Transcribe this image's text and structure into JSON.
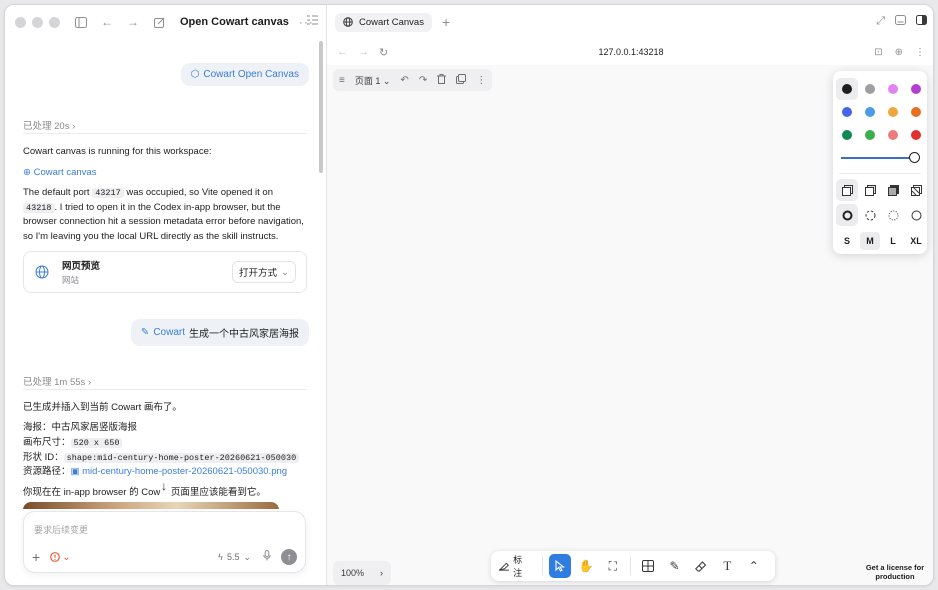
{
  "left_titlebar": {
    "title": "Open Cowart canvas",
    "more": "···"
  },
  "chat": {
    "user_msg_1": {
      "mention": "Cowart Open Canvas"
    },
    "processed_1": "已处理 20s",
    "assistant_1": {
      "line_1": "Cowart canvas is running for this workspace:",
      "link_1": "Cowart canvas",
      "p2_a": "The default port ",
      "port_default": "43217",
      "p2_b": " was occupied, so Vite opened it on",
      "port_used": "43218",
      "p2_c": ". I tried to open it in the Codex in-app browser, but the browser connection hit a session metadata error before navigation, so I'm leaving you the local URL directly as the skill instructs."
    },
    "preview_card": {
      "title": "网页预览",
      "subtitle": "网站",
      "open_button": "打开方式"
    },
    "user_msg_2": {
      "mention": "Cowart",
      "text": "生成一个中古风家居海报"
    },
    "processed_2": "已处理 1m 55s",
    "assistant_2": {
      "line_1": "已生成并插入到当前 Cowart 画布了。",
      "poster_label": "海报：",
      "poster_value": "中古风家居竖版海报",
      "size_label": "画布尺寸：",
      "size_value": "520 x 650",
      "shape_label": "形状 ID：",
      "shape_value": "shape:mid-century-home-poster-20260621-050030",
      "path_label": "资源路径：",
      "path_value": "mid-century-home-poster-20260621-050030.png",
      "line_last_a": "你现在在 in-app browser 的 Cow",
      "line_last_b": "页面里应该能看到它。"
    }
  },
  "composer": {
    "placeholder": "要求后续变更",
    "model": "5.5"
  },
  "browser": {
    "tab_title": "Cowart Canvas",
    "url": "127.0.0.1:43218"
  },
  "canvas": {
    "page_label": "页面 1",
    "zoom": "100%",
    "annotate_label": "标注",
    "license_text": "Get a license for production",
    "size_options": [
      "S",
      "M",
      "L",
      "XL"
    ],
    "selected_size": "M",
    "colors": [
      "#1d1d1d",
      "#9e9ea3",
      "#e085f0",
      "#b23fd0",
      "#4467e8",
      "#4a9ce8",
      "#f0a63c",
      "#e86f22",
      "#0f8a55",
      "#3cae4d",
      "#ef7c7c",
      "#e0312f"
    ],
    "selected_color": "#1d1d1d",
    "accent_color": "#2f7de1",
    "stroke_width": 1.0
  }
}
